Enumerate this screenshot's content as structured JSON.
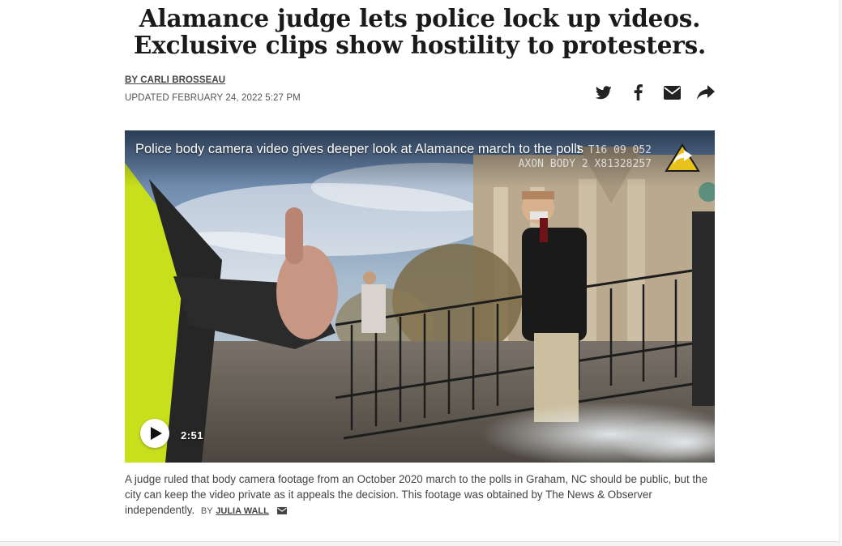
{
  "article": {
    "headline_line1": "Alamance judge lets police lock up videos.",
    "headline_line2": "Exclusive clips show hostility to protesters.",
    "byline": "BY CARLI BROSSEAU",
    "updated": "UPDATED FEBRUARY 24, 2022 5:27 PM"
  },
  "share": {
    "icons": [
      "twitter-icon",
      "facebook-icon",
      "email-icon",
      "share-arrow-icon"
    ]
  },
  "video": {
    "title": "Police body camera video gives deeper look at Alamance march to the polls",
    "cam_stamp_line1": "1 T16 09 052",
    "cam_stamp_line2": "AXON BODY 2 X81328257",
    "duration": "2:51"
  },
  "caption": {
    "text": "A judge ruled that body camera footage from an October 2020 march to the polls in Graham, NC should be public, but the city can keep the video private as it appeals the decision. This footage was obtained by The News & Observer independently.",
    "by": "BY",
    "author": "JULIA WALL"
  },
  "colors": {
    "headline": "#1a1a1a",
    "logo_yellow": "#e8c21a",
    "icon": "#222222"
  }
}
